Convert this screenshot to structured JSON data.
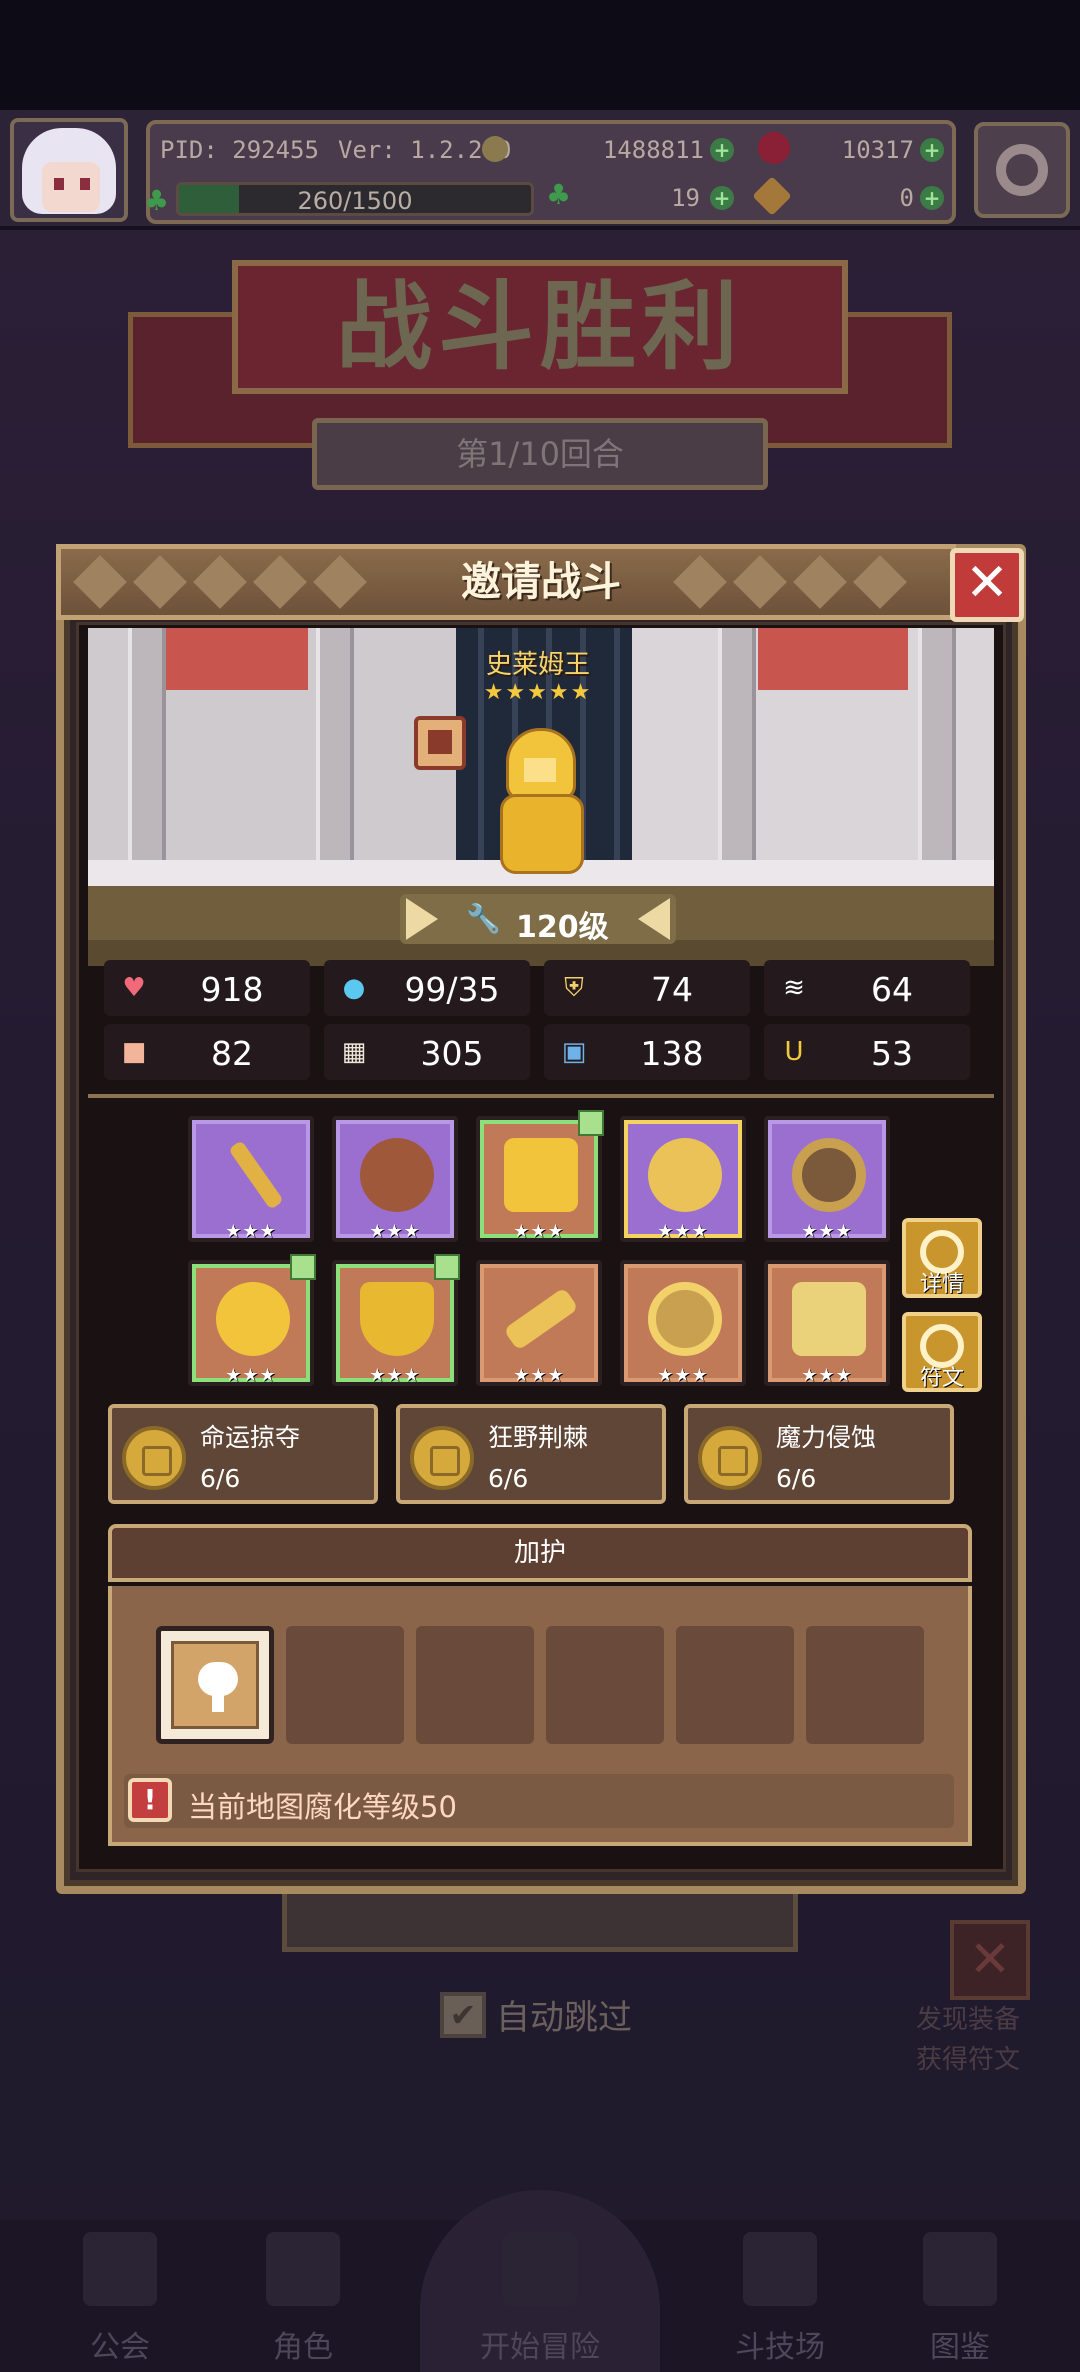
{
  "topbar": {
    "pid": "PID: 292455",
    "version": "Ver: 1.2.2.0",
    "gold": "1488811",
    "gems": "10317",
    "stamina": "260/1500",
    "stamina_fill": 0.17,
    "clover": "19",
    "item": "0"
  },
  "battle": {
    "title": "战斗胜利",
    "round": "第1/10回合",
    "auto_skip": "自动跳过",
    "auto_skip_checked": true,
    "hint": "发现装备 获得符文"
  },
  "nav": {
    "items": [
      "公会",
      "角色",
      "开始冒险",
      "斗技场",
      "图鉴"
    ]
  },
  "modal": {
    "title": "邀请战斗",
    "boss_name": "史莱姆王",
    "boss_stars": "★★★★★",
    "level": "120级",
    "stats": [
      {
        "icon": "heart-icon",
        "value": "918"
      },
      {
        "icon": "mana-drop-icon",
        "value": "99/35"
      },
      {
        "icon": "shield-icon",
        "value": "74"
      },
      {
        "icon": "wing-icon",
        "value": "64"
      },
      {
        "icon": "fist-icon",
        "value": "82"
      },
      {
        "icon": "book-icon",
        "value": "305"
      },
      {
        "icon": "potion-icon",
        "value": "138"
      },
      {
        "icon": "horseshoe-icon",
        "value": "53"
      }
    ],
    "equipment_stars": "★★★",
    "details_label": "详情",
    "runes_label": "符文",
    "sets": [
      {
        "name": "命运掠夺",
        "count": "6/6"
      },
      {
        "name": "狂野荆棘",
        "count": "6/6"
      },
      {
        "name": "魔力侵蚀",
        "count": "6/6"
      }
    ],
    "buff_title": "加护",
    "warning": "当前地图腐化等级50"
  },
  "colors": {
    "accent_gold": "#c8a877",
    "rarity_purple": "#9b6fd0",
    "rarity_orange": "#c17a57",
    "upgrade_green": "#8ce07a",
    "close_red": "#c23b3b"
  }
}
